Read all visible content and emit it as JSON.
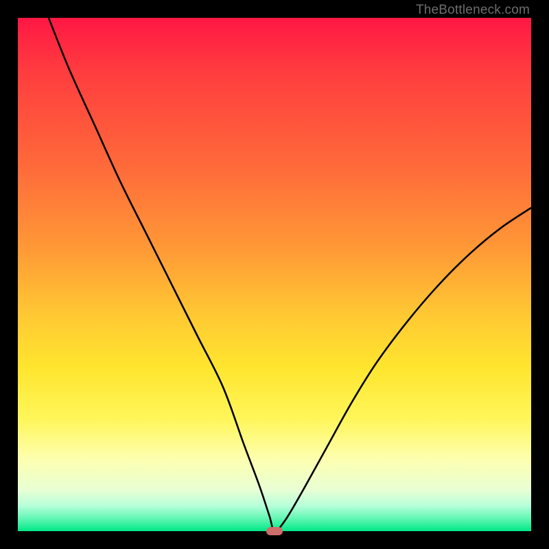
{
  "watermark": "TheBottleneck.com",
  "colors": {
    "frame": "#000000",
    "curve": "#000000",
    "marker": "#cd6e6c",
    "gradient_top": "#ff1744",
    "gradient_bottom": "#00e888"
  },
  "chart_data": {
    "type": "line",
    "title": "",
    "xlabel": "",
    "ylabel": "",
    "xlim": [
      0,
      100
    ],
    "ylim": [
      0,
      100
    ],
    "x": [
      6,
      10,
      15,
      20,
      25,
      30,
      35,
      40,
      44,
      47,
      49,
      50,
      52,
      55,
      60,
      65,
      70,
      76,
      82,
      88,
      94,
      100
    ],
    "values": [
      100,
      90,
      79,
      68,
      58,
      48,
      38,
      28,
      17,
      9,
      3,
      0,
      2,
      7,
      16,
      25,
      33,
      41,
      48,
      54,
      59,
      63
    ],
    "marker": {
      "x": 50,
      "y": 0
    },
    "note": "V-shaped bottleneck curve; minimum at x≈50 reaching y=0. Left branch starts at top-left (x≈6, y=100) descending roughly linearly to minimum. Right branch rises with decreasing slope toward x=100, y≈63. Background is a red→yellow→green vertical gradient (red=high bottleneck, green=low)."
  }
}
